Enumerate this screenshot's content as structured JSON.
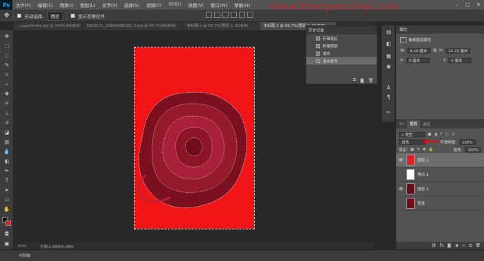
{
  "app": {
    "logo": "Ps"
  },
  "menu": [
    "文件(F)",
    "编辑(E)",
    "图像(I)",
    "图层(L)",
    "文字(Y)",
    "选择(S)",
    "滤镜(T)",
    "3D(D)",
    "视图(V)",
    "窗口(W)",
    "帮助(H)"
  ],
  "window_controls": [
    "–",
    "□",
    "✕"
  ],
  "options": {
    "auto_select_label": "自动选择:",
    "auto_select_value": "图层",
    "show_transform_label": "显示变换控件"
  },
  "watermark": "www.hiwoyouxinqi.com",
  "tabs": [
    "...pgqkhmkq.jpg @ 100%(RGB/8)",
    "1659171_15464358182_2.jpg @ 66.7%(RGB/8)",
    "未标题-1 @ 66.7%(图层 2, RGB/8)",
    "未标题-2 @ 66.7%(图层 2, RGB/8)"
  ],
  "status": {
    "zoom": "50%",
    "doc": "文档:1.99M/5.48M"
  },
  "timeline_label": "时间轴",
  "history": {
    "title": "历史记录",
    "items": [
      "存储选区",
      "新建图层",
      "填充",
      "混合更改"
    ],
    "active_index": 3
  },
  "properties": {
    "title": "属性",
    "subtitle": "像素图层属性",
    "w_label": "W:",
    "w_value": "9.44 厘米",
    "h_label": "H:",
    "h_value": "14.22 厘米",
    "x_label": "X:",
    "x_value": "0 厘米",
    "y_label": "Y:",
    "y_value": "0 厘米"
  },
  "layers_panel": {
    "tabs": [
      "3D",
      "图层",
      "通道"
    ],
    "active_tab": 1,
    "kind_filter": "类型",
    "blend_mode": "滤色",
    "opacity_label": "不透明度:",
    "opacity_value": "100%",
    "lock_label": "锁定:",
    "fill_label": "填充:",
    "fill_value": "100%",
    "layers": [
      {
        "name": "图层 2",
        "visible": true,
        "thumb": "#e02020",
        "active": true
      },
      {
        "name": "黑白 1",
        "visible": false,
        "thumb": "#ffffff",
        "active": false
      },
      {
        "name": "图层 1",
        "visible": true,
        "thumb": "#6a0a18",
        "active": false
      },
      {
        "name": "背景",
        "visible": false,
        "thumb": "#7a0a18",
        "active": false
      }
    ]
  },
  "colors": {
    "canvas_red": "#f01414",
    "rose": "#8f1526",
    "arrow": "#ff0000"
  }
}
